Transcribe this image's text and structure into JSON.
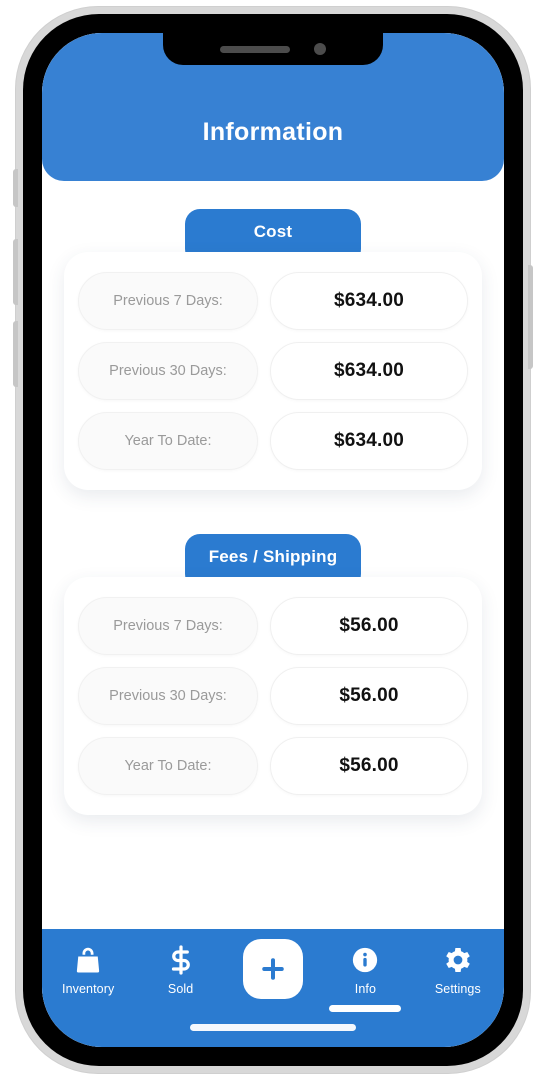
{
  "theme": {
    "header_blue": "#3781d3",
    "tab_blue": "#2b7bd0",
    "nav_blue": "#2b7bd0",
    "card_white": "#ffffff",
    "label_gray": "#9a9a9a",
    "value_black": "#111111"
  },
  "header": {
    "title": "Information"
  },
  "sections": [
    {
      "tab_label": "Cost",
      "rows": [
        {
          "label": "Previous 7 Days:",
          "value": "$634.00"
        },
        {
          "label": "Previous 30 Days:",
          "value": "$634.00"
        },
        {
          "label": "Year To Date:",
          "value": "$634.00"
        }
      ]
    },
    {
      "tab_label": "Fees / Shipping",
      "rows": [
        {
          "label": "Previous 7 Days:",
          "value": "$56.00"
        },
        {
          "label": "Previous 30 Days:",
          "value": "$56.00"
        },
        {
          "label": "Year To Date:",
          "value": "$56.00"
        }
      ]
    }
  ],
  "bottom_nav": {
    "items": [
      {
        "label": "Inventory",
        "icon": "shopping-bag-icon",
        "active": false
      },
      {
        "label": "Sold",
        "icon": "dollar-sign-icon",
        "active": false
      },
      {
        "label": "",
        "icon": "plus-icon",
        "active": false
      },
      {
        "label": "Info",
        "icon": "info-circle-icon",
        "active": true
      },
      {
        "label": "Settings",
        "icon": "gear-icon",
        "active": false
      }
    ]
  }
}
